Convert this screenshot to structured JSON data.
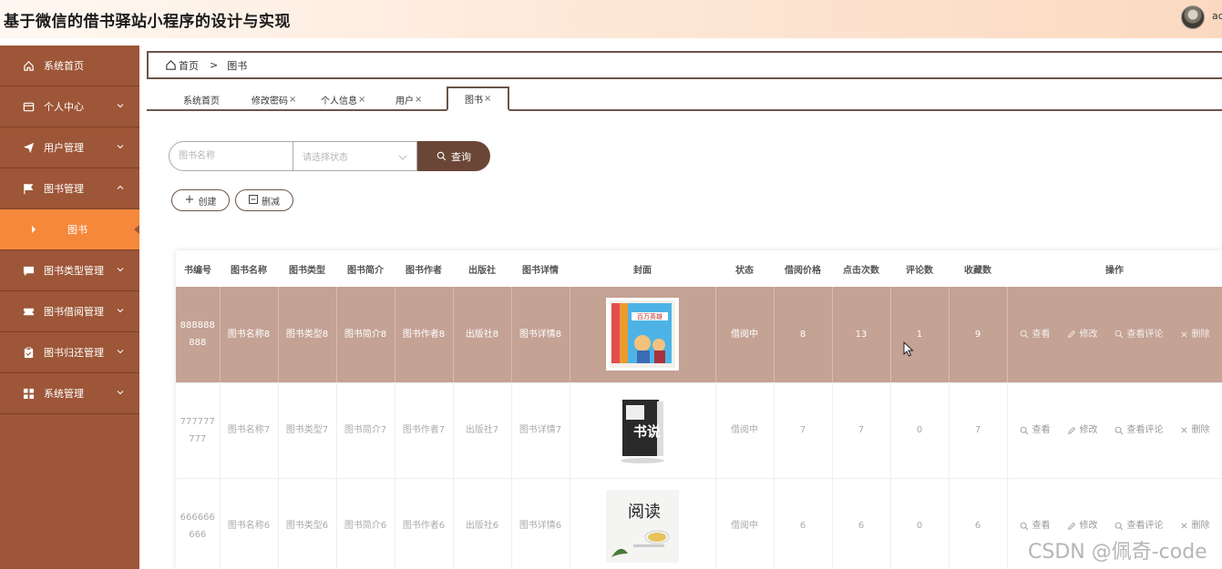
{
  "header": {
    "title": "基于微信的借书驿站小程序的设计与实现",
    "user": "ac"
  },
  "sidebar": {
    "items": [
      {
        "label": "系统首页",
        "icon": "home-icon"
      },
      {
        "label": "个人中心",
        "icon": "card-icon"
      },
      {
        "label": "用户管理",
        "icon": "send-icon"
      },
      {
        "label": "图书管理",
        "icon": "flag-icon"
      },
      {
        "label": "图书",
        "icon": "caret-right-icon"
      },
      {
        "label": "图书类型管理",
        "icon": "chat-icon"
      },
      {
        "label": "图书借阅管理",
        "icon": "ticket-icon"
      },
      {
        "label": "图书归还管理",
        "icon": "clipboard-icon"
      },
      {
        "label": "系统管理",
        "icon": "grid-icon"
      }
    ]
  },
  "breadcrumb": {
    "home": "首页",
    "separator": ">",
    "current": "图书"
  },
  "tabs": [
    {
      "label": "系统首页",
      "close": ""
    },
    {
      "label": "修改密码",
      "close": "×"
    },
    {
      "label": "个人信息",
      "close": "×"
    },
    {
      "label": "用户",
      "close": "×"
    },
    {
      "label": "图书",
      "close": "×"
    }
  ],
  "search": {
    "name_placeholder": "图书名称",
    "status_placeholder": "请选择状态",
    "query_label": "查询"
  },
  "actions": {
    "create_label": "创建",
    "delete_label": "删减"
  },
  "table": {
    "columns": [
      "书编号",
      "图书名称",
      "图书类型",
      "图书简介",
      "图书作者",
      "出版社",
      "图书详情",
      "封面",
      "状态",
      "借阅价格",
      "点击次数",
      "评论数",
      "收藏数",
      "操作"
    ],
    "rows": [
      {
        "no": "888888888",
        "name": "图书名称8",
        "type": "图书类型8",
        "intro": "图书简介8",
        "author": "图书作者8",
        "publisher": "出版社8",
        "detail": "图书详情8",
        "status": "借阅中",
        "price": "8",
        "clicks": "13",
        "comments": "1",
        "favorites": "9"
      },
      {
        "no": "777777777",
        "name": "图书名称7",
        "type": "图书类型7",
        "intro": "图书简介7",
        "author": "图书作者7",
        "publisher": "出版社7",
        "detail": "图书详情7",
        "status": "借阅中",
        "price": "7",
        "clicks": "7",
        "comments": "0",
        "favorites": "7"
      },
      {
        "no": "666666666",
        "name": "图书名称6",
        "type": "图书类型6",
        "intro": "图书简介6",
        "author": "图书作者6",
        "publisher": "出版社6",
        "detail": "图书详情6",
        "status": "借阅中",
        "price": "6",
        "clicks": "6",
        "comments": "0",
        "favorites": "6"
      }
    ],
    "ops": {
      "view": "查看",
      "edit": "修改",
      "view_comments": "查看评论",
      "delete": "删除"
    },
    "covers": [
      {
        "text": "百万英雄"
      },
      {
        "text": "书说"
      },
      {
        "text": "阅读"
      }
    ]
  },
  "colors": {
    "sidebar": "#9d5637",
    "active_menu": "#f5883a",
    "highlight_row": "#c4a294",
    "button": "#6b4637"
  },
  "watermark": "CSDN @佩奇-code"
}
